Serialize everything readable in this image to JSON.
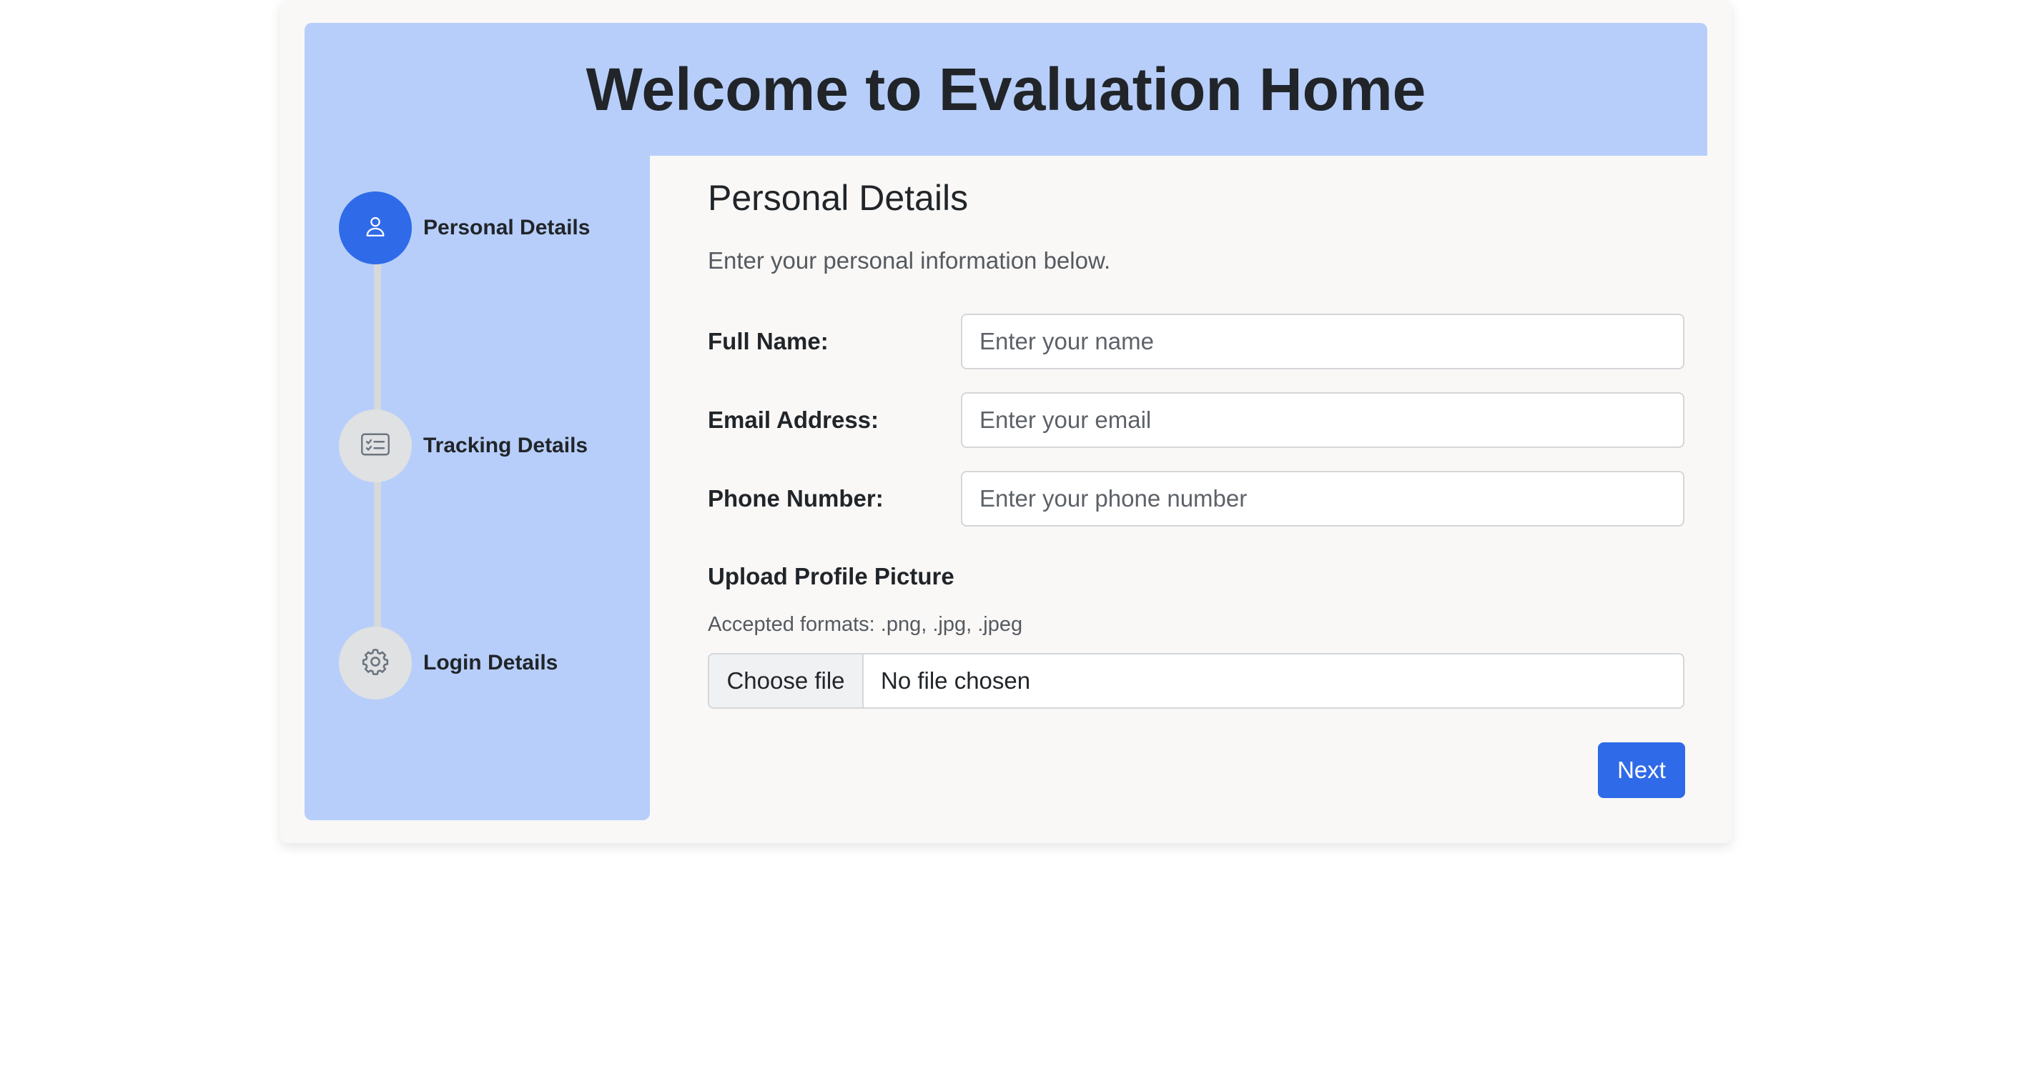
{
  "header": {
    "title": "Welcome to Evaluation Home"
  },
  "steps": [
    {
      "label": "Personal Details",
      "icon": "person-icon",
      "active": true
    },
    {
      "label": "Tracking Details",
      "icon": "checklist-card-icon",
      "active": false
    },
    {
      "label": "Login Details",
      "icon": "gear-icon",
      "active": false
    }
  ],
  "form": {
    "title": "Personal Details",
    "subtitle": "Enter your personal information below.",
    "fields": [
      {
        "label": "Full Name:",
        "placeholder": "Enter your name",
        "value": ""
      },
      {
        "label": "Email Address:",
        "placeholder": "Enter your email",
        "value": ""
      },
      {
        "label": "Phone Number:",
        "placeholder": "Enter your phone number",
        "value": ""
      }
    ],
    "upload": {
      "title": "Upload Profile Picture",
      "formats": "Accepted formats: .png, .jpg, .jpeg",
      "button_label": "Choose file",
      "status": "No file chosen"
    },
    "next_label": "Next"
  },
  "colors": {
    "accent": "#2f6ae8",
    "panel": "#b7cefa",
    "card": "#f9f8f6",
    "inactive_step": "#e0e1e3"
  }
}
